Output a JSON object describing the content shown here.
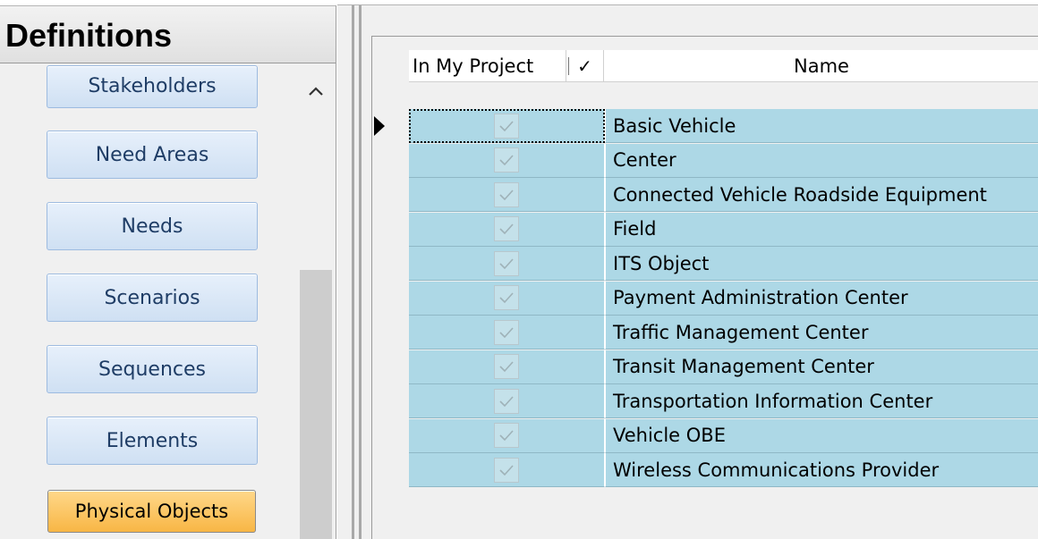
{
  "sidebar": {
    "title": "Definitions",
    "items": [
      {
        "label": "Stakeholders"
      },
      {
        "label": "Need Areas"
      },
      {
        "label": "Needs"
      },
      {
        "label": "Scenarios"
      },
      {
        "label": "Sequences"
      },
      {
        "label": "Elements"
      },
      {
        "label": "Physical Objects",
        "active": true
      }
    ],
    "scroll_up_icon": "chevron-up-icon"
  },
  "grid": {
    "columns": {
      "in_my_project": "In My Project",
      "check_symbol": "✓",
      "name": "Name"
    },
    "rows": [
      {
        "name": "Basic Vehicle",
        "checked": true,
        "current": true
      },
      {
        "name": "Center",
        "checked": true
      },
      {
        "name": "Connected Vehicle Roadside Equipment",
        "checked": true
      },
      {
        "name": "Field",
        "checked": true
      },
      {
        "name": "ITS Object",
        "checked": true
      },
      {
        "name": "Payment Administration Center",
        "checked": true
      },
      {
        "name": "Traffic Management Center",
        "checked": true
      },
      {
        "name": "Transit Management Center",
        "checked": true
      },
      {
        "name": "Transportation Information Center",
        "checked": true
      },
      {
        "name": "Vehicle OBE",
        "checked": true
      },
      {
        "name": "Wireless Communications  Provider",
        "checked": true
      }
    ],
    "row_color": "#add8e6",
    "active_button_color": "#f8b645"
  }
}
